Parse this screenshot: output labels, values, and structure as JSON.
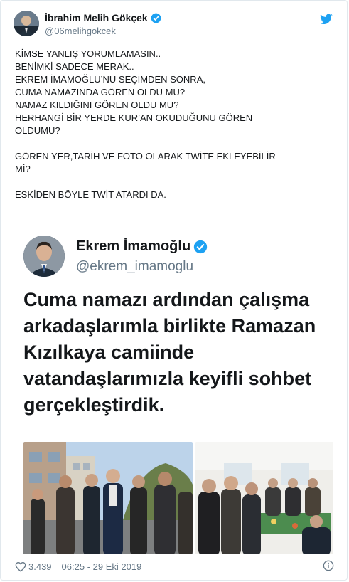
{
  "author": {
    "name": "İbrahim Melih Gökçek",
    "handle": "@06melihgokcek"
  },
  "tweet": {
    "lines": [
      "KİMSE YANLIŞ YORUMLAMASIN..",
      "BENİMKİ SADECE MERAK..",
      "EKREM İMAMOĞLU’NU SEÇİMDEN SONRA,",
      "CUMA NAMAZINDA GÖREN OLDU MU?",
      "NAMAZ KILDIĞINI GÖREN OLDU MU?",
      "HERHANGİ BİR YERDE KUR’AN OKUDUĞUNU GÖREN",
      "OLDUMU?",
      "",
      "GÖREN YER,TARİH VE FOTO OLARAK TWİTE EKLEYEBİLİR",
      "Mİ?",
      "",
      "ESKİDEN BÖYLE TWİT ATARDI DA."
    ]
  },
  "embedded": {
    "name": "Ekrem İmamoğlu",
    "handle": "@ekrem_imamoglu",
    "lines": [
      "Cuma namazı ardından çalışma",
      "arkadaşlarımla birlikte Ramazan",
      "Kızılkaya camiinde",
      "vatandaşlarımızla keyifli sohbet",
      "gerçekleştirdik."
    ]
  },
  "footer": {
    "likes": "3.439",
    "timestamp": "06:25 - 29 Eki 2019"
  },
  "colors": {
    "twitter_blue": "#1da1f2",
    "secondary_text": "#657786"
  },
  "icons": [
    "verified-badge-icon",
    "twitter-bird-icon",
    "heart-icon",
    "info-icon"
  ]
}
